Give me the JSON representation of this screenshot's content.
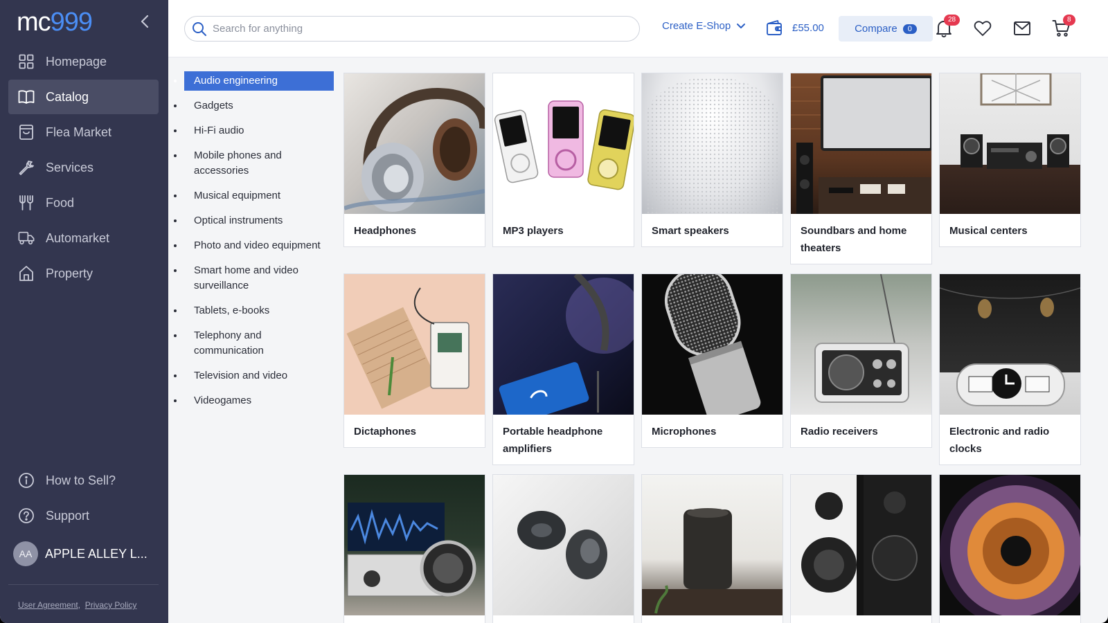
{
  "brand": {
    "logo_mc": "mc",
    "logo_num": "999"
  },
  "sidebar": {
    "items": [
      {
        "label": "Homepage",
        "icon": "grid-icon"
      },
      {
        "label": "Catalog",
        "icon": "book-icon"
      },
      {
        "label": "Flea Market",
        "icon": "bag-icon"
      },
      {
        "label": "Services",
        "icon": "wrench-icon"
      },
      {
        "label": "Food",
        "icon": "fork-knife-icon"
      },
      {
        "label": "Automarket",
        "icon": "truck-icon"
      },
      {
        "label": "Property",
        "icon": "home-icon"
      }
    ],
    "active": "Catalog",
    "bottom_items": [
      {
        "label": "How to Sell?",
        "icon": "info-icon"
      },
      {
        "label": "Support",
        "icon": "help-icon"
      }
    ],
    "user": {
      "initials": "AA",
      "name": "APPLE ALLEY L..."
    },
    "footer": {
      "agreement": "User Agreement",
      "separator": ",",
      "privacy": "Privacy Policy"
    }
  },
  "topbar": {
    "search_placeholder": "Search for anything",
    "create_shop": "Create E-Shop",
    "wallet": "£55.00",
    "compare": {
      "label": "Compare",
      "count": "0"
    },
    "notifications_count": "28",
    "cart_count": "8"
  },
  "categories": {
    "items": [
      "Audio engineering",
      "Gadgets",
      "Hi-Fi audio",
      "Mobile phones and accessories",
      "Musical equipment",
      "Optical instruments",
      "Photo and video equipment",
      "Smart home and video surveillance",
      "Tablets, e-books",
      "Telephony and communication",
      "Television and video",
      "Videogames"
    ],
    "active": "Audio engineering"
  },
  "products": [
    {
      "label": "Headphones"
    },
    {
      "label": "MP3 players"
    },
    {
      "label": "Smart speakers"
    },
    {
      "label": "Soundbars and home theaters"
    },
    {
      "label": "Musical centers"
    },
    {
      "label": "Dictaphones"
    },
    {
      "label": "Portable headphone amplifiers"
    },
    {
      "label": "Microphones"
    },
    {
      "label": "Radio receivers"
    },
    {
      "label": "Electronic and radio clocks"
    },
    {
      "label": ""
    },
    {
      "label": ""
    },
    {
      "label": ""
    },
    {
      "label": ""
    },
    {
      "label": ""
    }
  ],
  "colors": {
    "sidebar": "#33364f",
    "accent": "#2b5fc5",
    "active_category": "#3d6fd6",
    "badge": "#e53950"
  }
}
